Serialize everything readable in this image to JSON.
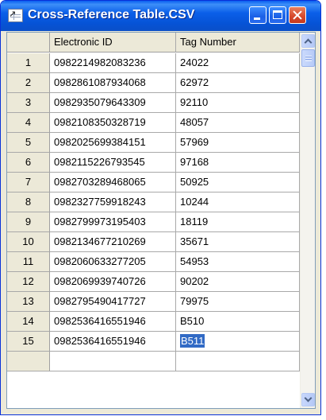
{
  "window": {
    "title": "Cross-Reference Table.CSV",
    "icon": "csv-file-icon",
    "controls": [
      "minimize-icon",
      "maximize-icon",
      "close-icon"
    ]
  },
  "table": {
    "columns": [
      "",
      "Electronic ID",
      "Tag Number"
    ],
    "rows": [
      {
        "num": "1",
        "electronic_id": "0982214982083236",
        "tag": "24022"
      },
      {
        "num": "2",
        "electronic_id": "0982861087934068",
        "tag": "62972"
      },
      {
        "num": "3",
        "electronic_id": "0982935079643309",
        "tag": "92110"
      },
      {
        "num": "4",
        "electronic_id": "0982108350328719",
        "tag": "48057"
      },
      {
        "num": "5",
        "electronic_id": "0982025699384151",
        "tag": "57969"
      },
      {
        "num": "6",
        "electronic_id": "0982115226793545",
        "tag": "97168"
      },
      {
        "num": "7",
        "electronic_id": "0982703289468065",
        "tag": "50925"
      },
      {
        "num": "8",
        "electronic_id": "0982327759918243",
        "tag": "10244"
      },
      {
        "num": "9",
        "electronic_id": "0982799973195403",
        "tag": "18119"
      },
      {
        "num": "10",
        "electronic_id": "0982134677210269",
        "tag": "35671"
      },
      {
        "num": "11",
        "electronic_id": "0982060633277205",
        "tag": "54953"
      },
      {
        "num": "12",
        "electronic_id": "0982069939740726",
        "tag": "90202"
      },
      {
        "num": "13",
        "electronic_id": "0982795490417727",
        "tag": "79975"
      },
      {
        "num": "14",
        "electronic_id": "0982536416551946",
        "tag": "B510"
      },
      {
        "num": "15",
        "electronic_id": "0982536416551946",
        "tag": "B511"
      }
    ],
    "selected_cell": {
      "row": 15,
      "column": "Tag Number"
    }
  },
  "colors": {
    "titlebar": "#0653d6",
    "selection": "#316ac5",
    "close_button": "#d6482b"
  }
}
